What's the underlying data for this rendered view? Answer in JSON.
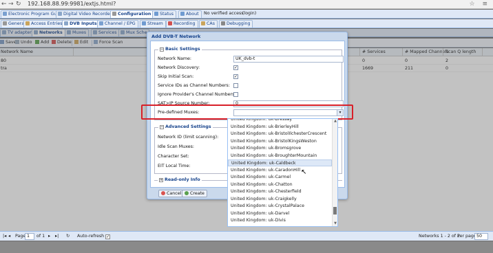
{
  "browser": {
    "url": "192.168.88.99:9981/extjs.html?"
  },
  "main_tabs": [
    "Electronic Program Guide",
    "Digital Video Recorder",
    "Configuration",
    "Status",
    "About"
  ],
  "status_text": [
    "No verified access",
    "(login)"
  ],
  "sub_tabs": [
    "General",
    "Access Entries",
    "DVB Inputs",
    "Channel / EPG",
    "Stream",
    "Recording",
    "CAs",
    "Debugging"
  ],
  "sub2_tabs": [
    "TV adapters",
    "Networks",
    "Muxes",
    "Services",
    "Mux Sche"
  ],
  "toolbar": {
    "save": "Save",
    "undo": "Undo",
    "add": "Add",
    "delete": "Delete",
    "edit": "Edit",
    "force_scan": "Force Scan"
  },
  "grid": {
    "columns": [
      "Network Name",
      "# Services",
      "# Mapped Channels",
      "Scan Q length"
    ],
    "rows": [
      {
        "name": "80",
        "services": "0",
        "mapped": "0",
        "scanq": "2"
      },
      {
        "name": "tra",
        "services": "1669",
        "mapped": "211",
        "scanq": "0"
      }
    ]
  },
  "paging": {
    "page_label": "Page",
    "page": "1",
    "of": "of 1",
    "auto_refresh": "Auto-refresh",
    "summary": "Networks 1 - 2 of 2",
    "per_page_label": "Per page",
    "per_page": "50"
  },
  "modal": {
    "title": "Add DVB-T Network",
    "basic_legend": "Basic Settings",
    "fields": {
      "network_name": {
        "label": "Network Name:",
        "value": "UK_dvb-t"
      },
      "network_discovery": {
        "label": "Network Discovery:",
        "checked": true
      },
      "skip_initial_scan": {
        "label": "Skip Initial Scan:",
        "checked": true
      },
      "service_ids": {
        "label": "Service IDs as Channel Numbers:",
        "checked": false
      },
      "ignore_provider": {
        "label": "Ignore Provider's Channel Numbers:",
        "checked": false
      },
      "satip_source": {
        "label": "SAT>IP Source Number:",
        "value": "0"
      },
      "predefined_muxes": {
        "label": "Pre-defined Muxes:",
        "value": ""
      }
    },
    "advanced_legend": "Advanced Settings",
    "advanced_labels": [
      "Network ID (limit scanning):",
      "Idle Scan Muxes:",
      "Character Set:",
      "EIT Local Time:"
    ],
    "readonly_legend": "Read-only Info",
    "cancel": "Cancel",
    "create": "Create"
  },
  "dropdown": {
    "items": [
      "United Kingdom: uk-Bressay",
      "United Kingdom: uk-BrierleyHill",
      "United Kingdom: uk-BristolIlchesterCrescent",
      "United Kingdom: uk-BristolKingsWeston",
      "United Kingdom: uk-Bromsgrove",
      "United Kingdom: uk-BroughterMountain",
      "United Kingdom: uk-Caldbeck",
      "United Kingdom: uk-CaradonHill",
      "United Kingdom: uk-Carmel",
      "United Kingdom: uk-Chatton",
      "United Kingdom: uk-Chesterfield",
      "United Kingdom: uk-Craigkelly",
      "United Kingdom: uk-CrystalPalace",
      "United Kingdom: uk-Darvel",
      "United Kingdom: uk-Divis"
    ],
    "hover_index": 6
  },
  "colors": {
    "accent": "#15428b",
    "highlight": "#d81f28"
  }
}
